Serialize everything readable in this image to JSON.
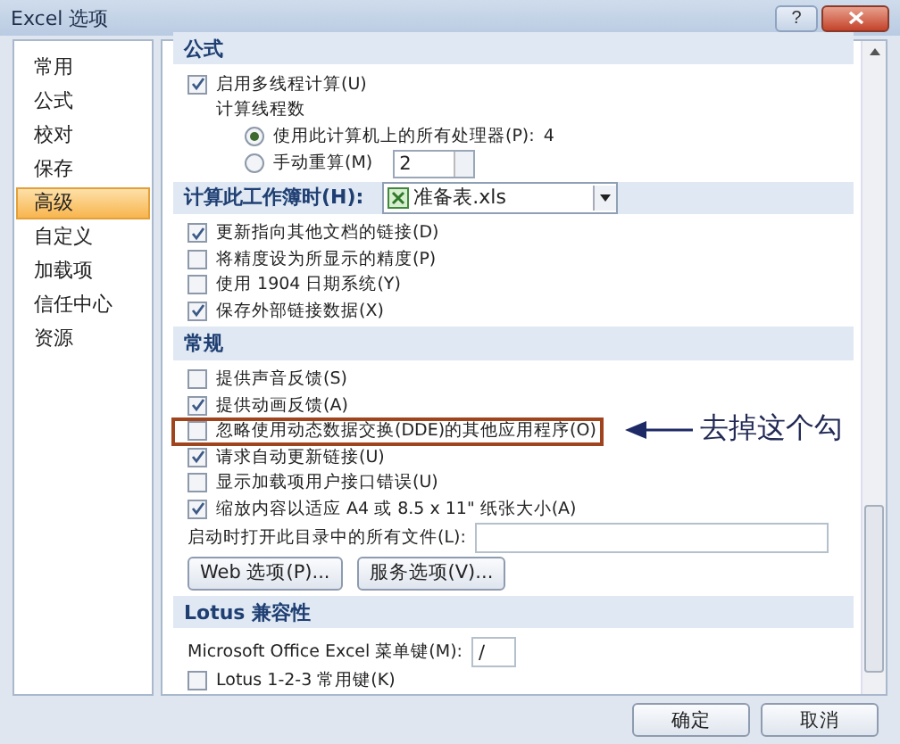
{
  "window": {
    "title": "Excel 选项",
    "help": "?"
  },
  "sidebar": {
    "items": [
      {
        "label": "常用",
        "selected": false
      },
      {
        "label": "公式",
        "selected": false
      },
      {
        "label": "校对",
        "selected": false
      },
      {
        "label": "保存",
        "selected": false
      },
      {
        "label": "高级",
        "selected": true
      },
      {
        "label": "自定义",
        "selected": false
      },
      {
        "label": "加载项",
        "selected": false
      },
      {
        "label": "信任中心",
        "selected": false
      },
      {
        "label": "资源",
        "selected": false
      }
    ]
  },
  "sections": [
    {
      "header": "公式",
      "items": [
        {
          "kind": "check",
          "label": "启用多线程计算(U)",
          "checked": true,
          "children": [
            {
              "kind": "text",
              "label": "计算线程数",
              "children": [
                {
                  "kind": "radio",
                  "label": "使用此计算机上的所有处理器(P):",
                  "value": "4",
                  "selected": true
                },
                {
                  "kind": "radio",
                  "label": "手动重算(M)",
                  "spinner": "2",
                  "selected": false
                }
              ]
            }
          ]
        }
      ]
    },
    {
      "header": "计算此工作簿时(H):",
      "dropdown": "准备表.xls",
      "items": [
        {
          "kind": "check",
          "label": "更新指向其他文档的链接(D)",
          "checked": true
        },
        {
          "kind": "check",
          "label": "将精度设为所显示的精度(P)",
          "checked": false
        },
        {
          "kind": "check",
          "label": "使用 1904 日期系统(Y)",
          "checked": false
        },
        {
          "kind": "check",
          "label": "保存外部链接数据(X)",
          "checked": true
        }
      ]
    },
    {
      "header": "常规",
      "items": [
        {
          "kind": "check",
          "label": "提供声音反馈(S)",
          "checked": false
        },
        {
          "kind": "check",
          "label": "提供动画反馈(A)",
          "checked": true
        },
        {
          "kind": "check",
          "label": "忽略使用动态数据交换(DDE)的其他应用程序(O)",
          "checked": false,
          "highlighted": true
        },
        {
          "kind": "check",
          "label": "请求自动更新链接(U)",
          "checked": true
        },
        {
          "kind": "check",
          "label": "显示加载项用户接口错误(U)",
          "checked": false
        },
        {
          "kind": "check",
          "label": "缩放内容以适应 A4 或 8.5 x 11\" 纸张大小(A)",
          "checked": true
        },
        {
          "kind": "field",
          "label": "启动时打开此目录中的所有文件(L):"
        },
        {
          "kind": "buttons",
          "buttons": [
            "Web 选项(P)...",
            "服务选项(V)..."
          ]
        }
      ]
    },
    {
      "header": "Lotus 兼容性",
      "items": [
        {
          "kind": "field",
          "label": "Microsoft Office Excel 菜单键(M):",
          "value": "/",
          "short": true
        },
        {
          "kind": "check",
          "label": "Lotus 1-2-3 常用键(K)",
          "checked": false
        }
      ]
    }
  ],
  "annotation": {
    "text": "去掉这个勾"
  },
  "footer": {
    "buttons": [
      "确定",
      "取消"
    ]
  }
}
